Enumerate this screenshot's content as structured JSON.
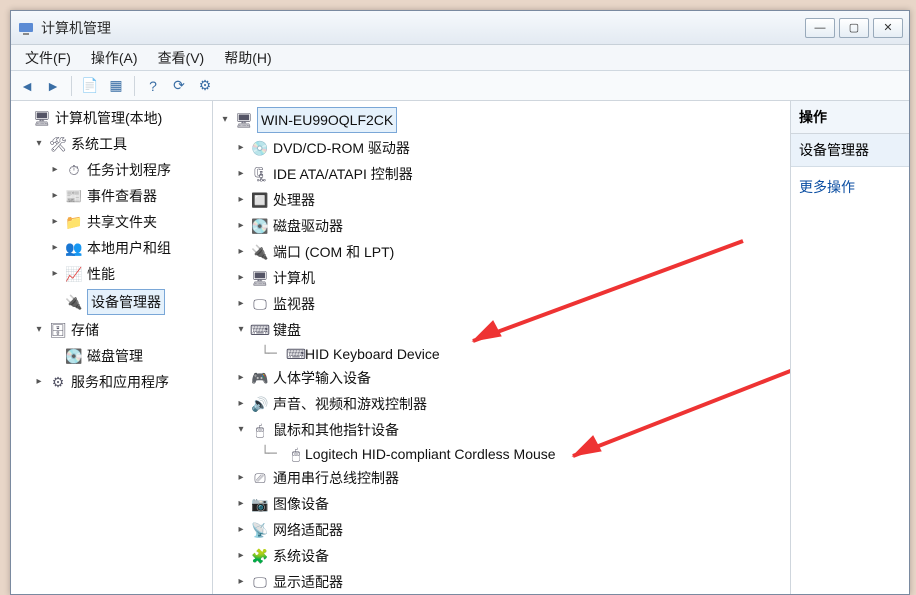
{
  "window": {
    "title": "计算机管理",
    "buttons": {
      "min": "—",
      "max": "▢",
      "close": "✕"
    }
  },
  "menubar": {
    "file": "文件(F)",
    "action": "操作(A)",
    "view": "查看(V)",
    "help": "帮助(H)"
  },
  "toolbar_icons": {
    "back": "back-icon",
    "fwd": "forward-icon",
    "up": "up-icon",
    "props": "properties-icon",
    "help": "help-icon",
    "scan": "scan-icon",
    "refresh": "refresh-icon"
  },
  "left_tree": {
    "root": "计算机管理(本地)",
    "sys_tools": {
      "label": "系统工具",
      "task_scheduler": "任务计划程序",
      "event_viewer": "事件查看器",
      "shared_folders": "共享文件夹",
      "local_users": "本地用户和组",
      "performance": "性能",
      "device_manager": "设备管理器"
    },
    "storage": {
      "label": "存储",
      "disk_mgmt": "磁盘管理"
    },
    "services": "服务和应用程序"
  },
  "device_tree": {
    "computer": "WIN-EU99OQLF2CK",
    "dvd": "DVD/CD-ROM 驱动器",
    "ide": "IDE ATA/ATAPI 控制器",
    "processors": "处理器",
    "disk_drives": "磁盘驱动器",
    "ports": "端口 (COM 和 LPT)",
    "computers": "计算机",
    "monitors": "监视器",
    "keyboards": "键盘",
    "keyboard_child": "HID Keyboard Device",
    "hid": "人体学输入设备",
    "sound": "声音、视频和游戏控制器",
    "mice": "鼠标和其他指针设备",
    "mouse_child": "Logitech HID-compliant Cordless Mouse",
    "usb": "通用串行总线控制器",
    "imaging": "图像设备",
    "network": "网络适配器",
    "system_dev": "系统设备",
    "display": "显示适配器"
  },
  "actions_pane": {
    "header": "操作",
    "subheader": "设备管理器",
    "more": "更多操作"
  }
}
